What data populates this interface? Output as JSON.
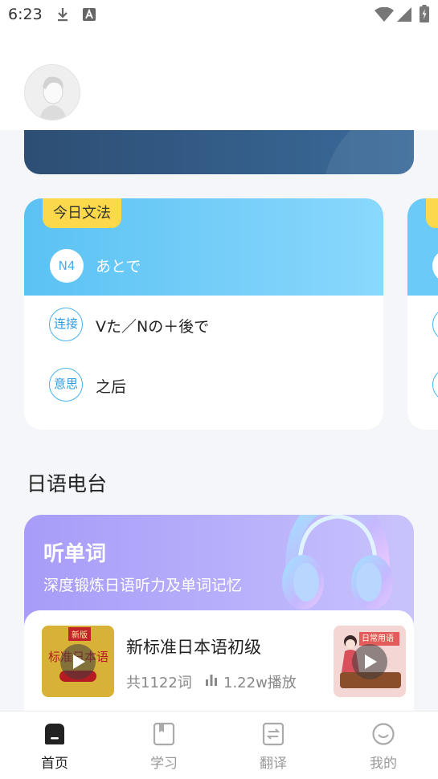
{
  "status_bar": {
    "time": "6:23"
  },
  "grammar": {
    "tag": "今日文法",
    "level": "N4",
    "word": "あとで",
    "connection_label": "连接",
    "connection": "Vた／Nの＋後で",
    "meaning_label": "意思",
    "meaning": "之后"
  },
  "radio": {
    "section_title": "日语电台",
    "title": "听单词",
    "subtitle": "深度锻炼日语听力及单词记忆",
    "items": [
      {
        "title": "新标准日本语初级",
        "count": "共1122词",
        "plays": "1.22w播放",
        "cover_badge": "新版",
        "cover_title": "标准日本语"
      }
    ],
    "next_cover_label": "日常用语"
  },
  "tabs": [
    {
      "label": "首页",
      "icon": "home-icon",
      "active": true
    },
    {
      "label": "学习",
      "icon": "book-icon",
      "active": false
    },
    {
      "label": "翻译",
      "icon": "translate-icon",
      "active": false
    },
    {
      "label": "我的",
      "icon": "profile-icon",
      "active": false
    }
  ],
  "colors": {
    "accent_blue": "#5bc2f3",
    "tag_yellow": "#fbd94a",
    "radio_purple": "#a79cf8",
    "banner_navy": "#2d4e74"
  }
}
